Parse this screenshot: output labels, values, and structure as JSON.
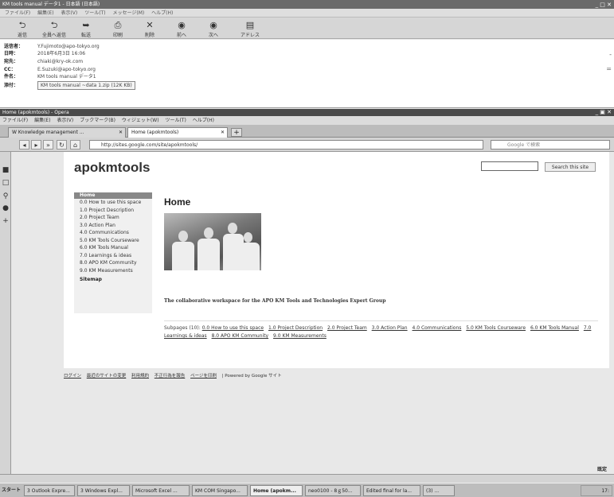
{
  "mail": {
    "title": "KM tools manual  データ1 - 日本語 (日本語)",
    "menu": [
      "ファイル(F)",
      "編集(E)",
      "表示(V)",
      "ツール(T)",
      "メッセージ(M)",
      "ヘルプ(H)"
    ],
    "toolbar": [
      {
        "label": "返信",
        "icon": "reply-icon"
      },
      {
        "label": "全員へ返信",
        "icon": "reply-all-icon"
      },
      {
        "label": "転送",
        "icon": "forward-icon"
      },
      {
        "label": "印刷",
        "icon": "print-icon"
      },
      {
        "label": "削除",
        "icon": "delete-icon"
      },
      {
        "label": "前へ",
        "icon": "previous-icon"
      },
      {
        "label": "次へ",
        "icon": "next-icon"
      },
      {
        "label": "アドレス",
        "icon": "address-book-icon"
      }
    ],
    "header": {
      "from_label": "送信者：",
      "from": "Y.Fujimoto@apo-tokyo.org",
      "date_label": "日時：",
      "date": "2018年6月3日 16:06",
      "to_label": "宛先：",
      "to": "chiaki@kry-ok.com",
      "cc_label": "CC：",
      "cc": "E.Suzuki@apo-tokyo.org",
      "subject_label": "件名：",
      "subject": "KM tools manual データ1",
      "attach_label": "添付：",
      "attach": "KM tools manual ~data 1.zip (12K KB)"
    }
  },
  "browser": {
    "title": "Home (apokmtools) - Opera",
    "menu": [
      "ファイル(F)",
      "編集(E)",
      "表示(V)",
      "ブックマーク(B)",
      "ウィジェット(W)",
      "ツール(T)",
      "ヘルプ(H)"
    ],
    "tabs": [
      {
        "label": "W Knowledge management ..."
      },
      {
        "label": "Home (apokmtools)"
      }
    ],
    "url": "http://sites.google.com/site/apokmtools/",
    "search_placeholder": "Google で検索"
  },
  "site": {
    "title": "apokmtools",
    "search_button": "Search this site",
    "nav_home": "Home",
    "nav": [
      "0.0 How to use this space",
      "1.0 Project Description",
      "2.0 Project Team",
      "3.0 Action Plan",
      "4.0 Communications",
      "5.0 KM Tools Courseware",
      "6.0 KM Tools Manual",
      "7.0 Learnings & ideas",
      "8.0 APO KM Community",
      "9.0 KM Measurements"
    ],
    "sitemap": "Sitemap",
    "heading": "Home",
    "tagline": "The collaborative workspace for the APO KM Tools and Technologies Expert Group",
    "subpages_label": "Subpages (10):",
    "subpages": [
      "0.0 How to use this space",
      "1.0 Project Description",
      "2.0 Project Team",
      "3.0 Action Plan",
      "4.0 Communications",
      "5.0 KM Tools Courseware",
      "6.0 KM Tools Manual",
      "7.0 Learnings & ideas",
      "8.0 APO KM Community",
      "9.0 KM Measurements"
    ],
    "footer": [
      "ログイン",
      "最近のサイトの変更",
      "利用規約",
      "不正行為を報告",
      "ページを印刷"
    ],
    "powered": "| Powered by Google サイト"
  },
  "corner_button": "既定",
  "taskbar": {
    "start": "スタート",
    "items": [
      "3 Outlook Expre...",
      "3 Windows Expl...",
      "Microsoft Excel ...",
      "KM COM Singapo...",
      "Home (apokm...",
      "neo0100 - 8ｇ50...",
      "Edited final for la...",
      "(3) ..."
    ],
    "clock": "17:"
  }
}
